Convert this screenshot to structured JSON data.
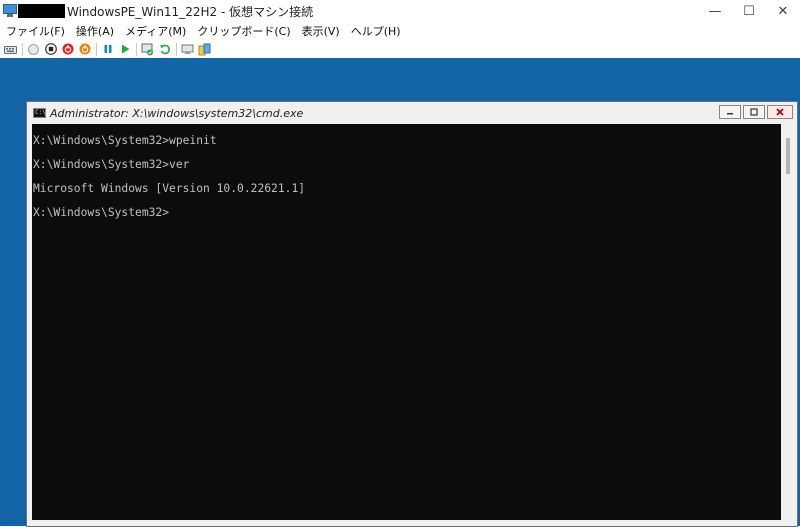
{
  "window": {
    "title": "WindowsPE_Win11_22H2 - 仮想マシン接続",
    "controls": {
      "minimize": "—",
      "maximize": "☐",
      "close": "✕"
    }
  },
  "menubar": [
    "ファイル(F)",
    "操作(A)",
    "メディア(M)",
    "クリップボード(C)",
    "表示(V)",
    "ヘルプ(H)"
  ],
  "toolbar": {
    "icons": [
      "ctrl-alt-del-icon",
      "start-icon",
      "stop-icon",
      "shutdown-icon",
      "power-icon",
      "pause-icon",
      "play-icon",
      "checkpoint-icon",
      "revert-icon",
      "enhanced-session-icon",
      "share-icon"
    ],
    "colors": {
      "shutdown": "#e02020",
      "power": "#f08000",
      "pause": "#1a7fd6",
      "play": "#2aa83a"
    }
  },
  "vm": {
    "background_color": "#1465a8",
    "cmd": {
      "title": "Administrator: X:\\windows\\system32\\cmd.exe",
      "icon_text": "C:\\",
      "lines": [
        "X:\\Windows\\System32>wpeinit",
        "",
        "X:\\Windows\\System32>ver",
        "",
        "Microsoft Windows [Version 10.0.22621.1]",
        "",
        "X:\\Windows\\System32>"
      ]
    }
  }
}
